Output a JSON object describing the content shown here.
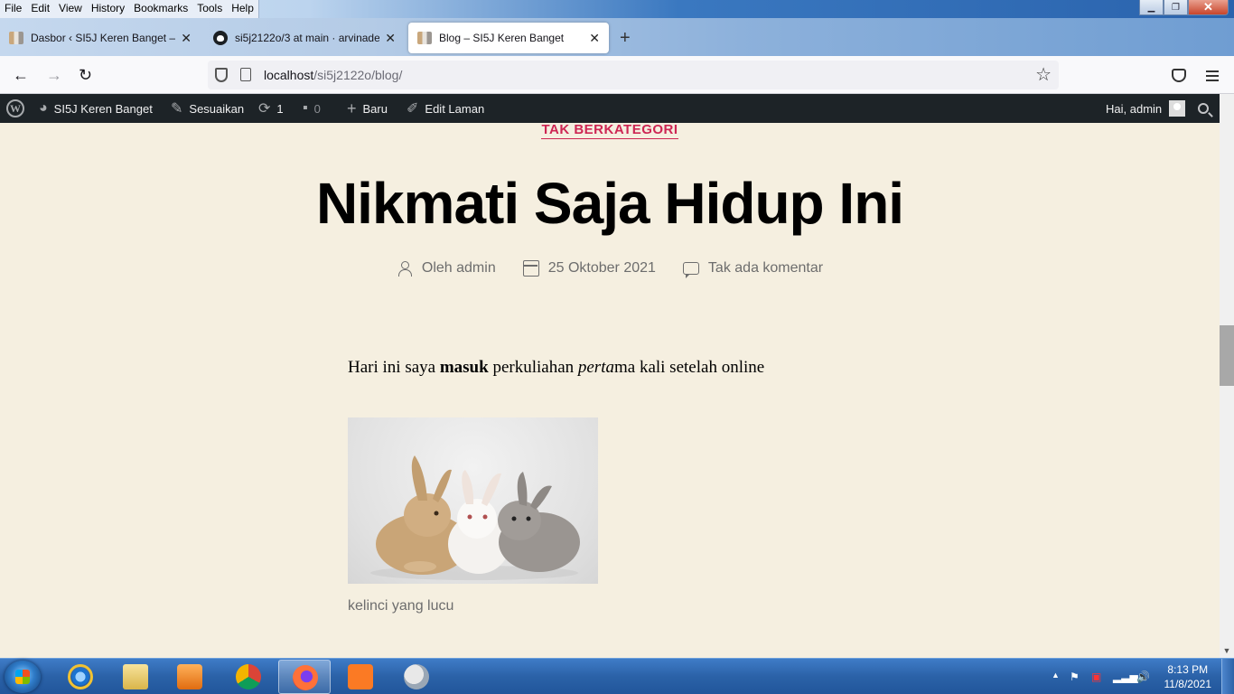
{
  "menubar": {
    "items": [
      "File",
      "Edit",
      "View",
      "History",
      "Bookmarks",
      "Tools",
      "Help"
    ]
  },
  "tabs": [
    {
      "title": "Dasbor ‹ SI5J Keren Banget — W",
      "active": false
    },
    {
      "title": "si5j2122o/3 at main · arvinadest",
      "active": false
    },
    {
      "title": "Blog – SI5J Keren Banget",
      "active": true
    }
  ],
  "navbar": {
    "url_host": "localhost",
    "url_path": "/si5j2122o/blog/"
  },
  "adminbar": {
    "site_name": "SI5J Keren Banget",
    "customize": "Sesuaikan",
    "updates_count": "1",
    "comments_count": "0",
    "new_label": "Baru",
    "edit_label": "Edit Laman",
    "greeting": "Hai, admin"
  },
  "post": {
    "category": "TAK BERKATEGORI",
    "title": "Nikmati Saja Hidup Ini",
    "author": "Oleh admin",
    "date": "25 Oktober 2021",
    "comments": "Tak ada komentar",
    "body": {
      "part1": "Hari ini saya ",
      "bold": "masuk",
      "part2": " perkuliahan ",
      "italic": "perta",
      "part3": "ma kali setelah online"
    },
    "image_caption": "kelinci yang lucu"
  },
  "taskbar": {
    "time": "8:13 PM",
    "date": "11/8/2021"
  },
  "colors": {
    "page_bg": "#f5efe0",
    "accent": "#cd2653",
    "adminbar_bg": "#1d2327"
  }
}
